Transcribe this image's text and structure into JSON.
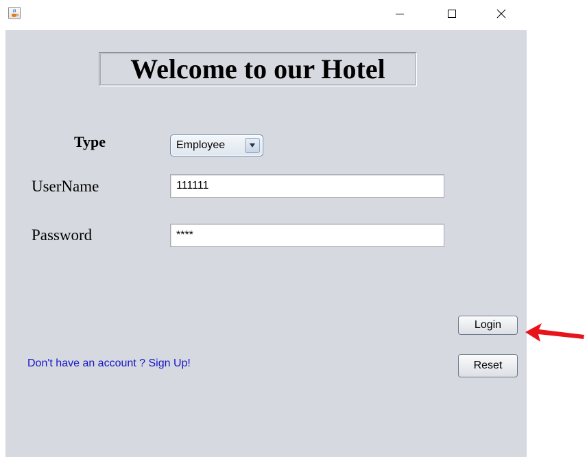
{
  "window": {
    "icon": "java-cup-icon",
    "controls": {
      "minimize_icon": "minimize-icon",
      "maximize_icon": "maximize-icon",
      "close_icon": "close-icon"
    }
  },
  "header": {
    "title": "Welcome to our Hotel"
  },
  "form": {
    "type_label": "Type",
    "type_selected": "Employee",
    "username_label": "UserName",
    "username_value": "111111",
    "password_label": "Password",
    "password_value": "****"
  },
  "actions": {
    "login_label": "Login",
    "reset_label": "Reset",
    "signup_link": "Don't have an account ? Sign Up!"
  },
  "annotation": {
    "arrow_icon": "red-arrow-icon",
    "arrow_color": "#e8141c"
  },
  "colors": {
    "panel_bg": "#d6d9df",
    "link": "#1515c8"
  }
}
